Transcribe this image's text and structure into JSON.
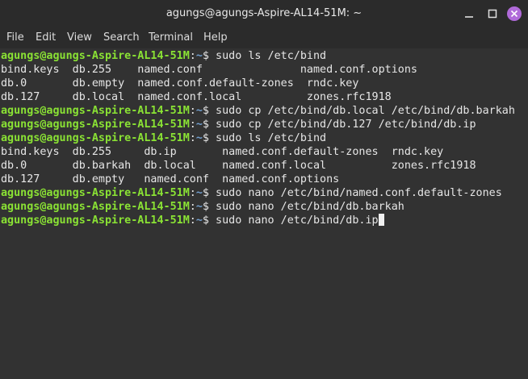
{
  "window": {
    "title": "agungs@agungs-Aspire-AL14-51M: ~"
  },
  "menu": [
    "File",
    "Edit",
    "View",
    "Search",
    "Terminal",
    "Help"
  ],
  "prompt": {
    "user": "agungs@agungs-Aspire-AL14-51M",
    "sep": ":",
    "path": "~",
    "symbol": "$ "
  },
  "lines": [
    {
      "type": "prompt",
      "cmd": "sudo ls /etc/bind"
    },
    {
      "type": "out",
      "text": "bind.keys  db.255    named.conf               named.conf.options"
    },
    {
      "type": "out",
      "text": "db.0       db.empty  named.conf.default-zones  rndc.key"
    },
    {
      "type": "out",
      "text": "db.127     db.local  named.conf.local          zones.rfc1918"
    },
    {
      "type": "prompt",
      "cmd": "sudo cp /etc/bind/db.local /etc/bind/db.barkah"
    },
    {
      "type": "prompt",
      "cmd": "sudo cp /etc/bind/db.127 /etc/bind/db.ip"
    },
    {
      "type": "prompt",
      "cmd": "sudo ls /etc/bind"
    },
    {
      "type": "out",
      "text": "bind.keys  db.255     db.ip       named.conf.default-zones  rndc.key"
    },
    {
      "type": "out",
      "text": "db.0       db.barkah  db.local    named.conf.local          zones.rfc1918"
    },
    {
      "type": "out",
      "text": "db.127     db.empty   named.conf  named.conf.options"
    },
    {
      "type": "prompt",
      "cmd": "sudo nano /etc/bind/named.conf.default-zones"
    },
    {
      "type": "prompt",
      "cmd": "sudo nano /etc/bind/db.barkah"
    },
    {
      "type": "prompt",
      "cmd": "sudo nano /etc/bind/db.ip",
      "cursor": true
    }
  ],
  "colors": {
    "user": "#8ae234",
    "path": "#729fcf",
    "text": "#e6e6e6",
    "background": "#323232",
    "close_button": "#b06ad9"
  }
}
